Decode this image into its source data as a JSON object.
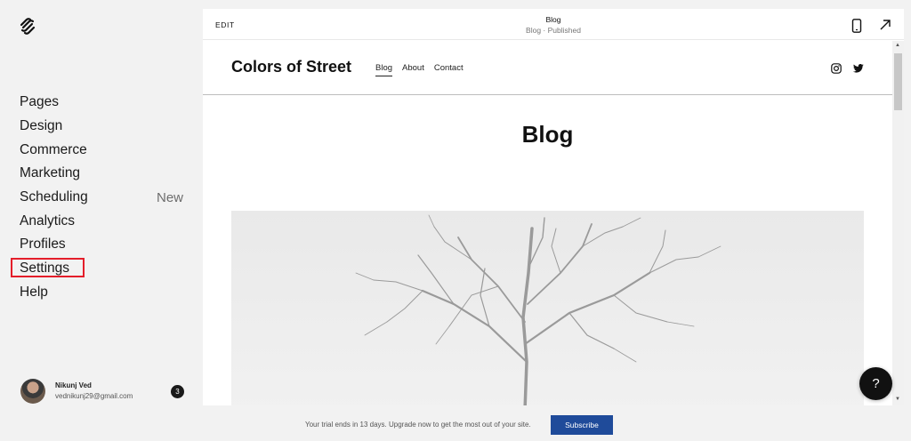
{
  "app": {
    "logo_icon": "squarespace-logo-icon"
  },
  "sidebar": {
    "items": [
      {
        "label": "Pages"
      },
      {
        "label": "Design"
      },
      {
        "label": "Commerce"
      },
      {
        "label": "Marketing"
      },
      {
        "label": "Scheduling",
        "badge": "New"
      },
      {
        "label": "Analytics"
      },
      {
        "label": "Profiles"
      },
      {
        "label": "Settings"
      },
      {
        "label": "Help"
      }
    ],
    "highlight_color": "#e41e2a"
  },
  "user": {
    "name": "Nikunj Ved",
    "email": "vednikunj29@gmail.com",
    "notifications": "3"
  },
  "editor": {
    "edit_label": "EDIT",
    "page_title": "Blog",
    "page_status": "Blog · Published",
    "icons": [
      "mobile-preview-icon",
      "open-external-icon"
    ]
  },
  "site": {
    "title": "Colors of Street",
    "nav": [
      {
        "label": "Blog",
        "active": true
      },
      {
        "label": "About"
      },
      {
        "label": "Contact"
      }
    ],
    "social_icons": [
      "instagram-icon",
      "twitter-icon"
    ],
    "heading": "Blog"
  },
  "help_button": {
    "label": "?"
  },
  "trial_bar": {
    "message": "Your trial ends in 13 days. Upgrade now to get the most out of your site.",
    "button_label": "Subscribe",
    "button_color": "#1f4b9a"
  }
}
